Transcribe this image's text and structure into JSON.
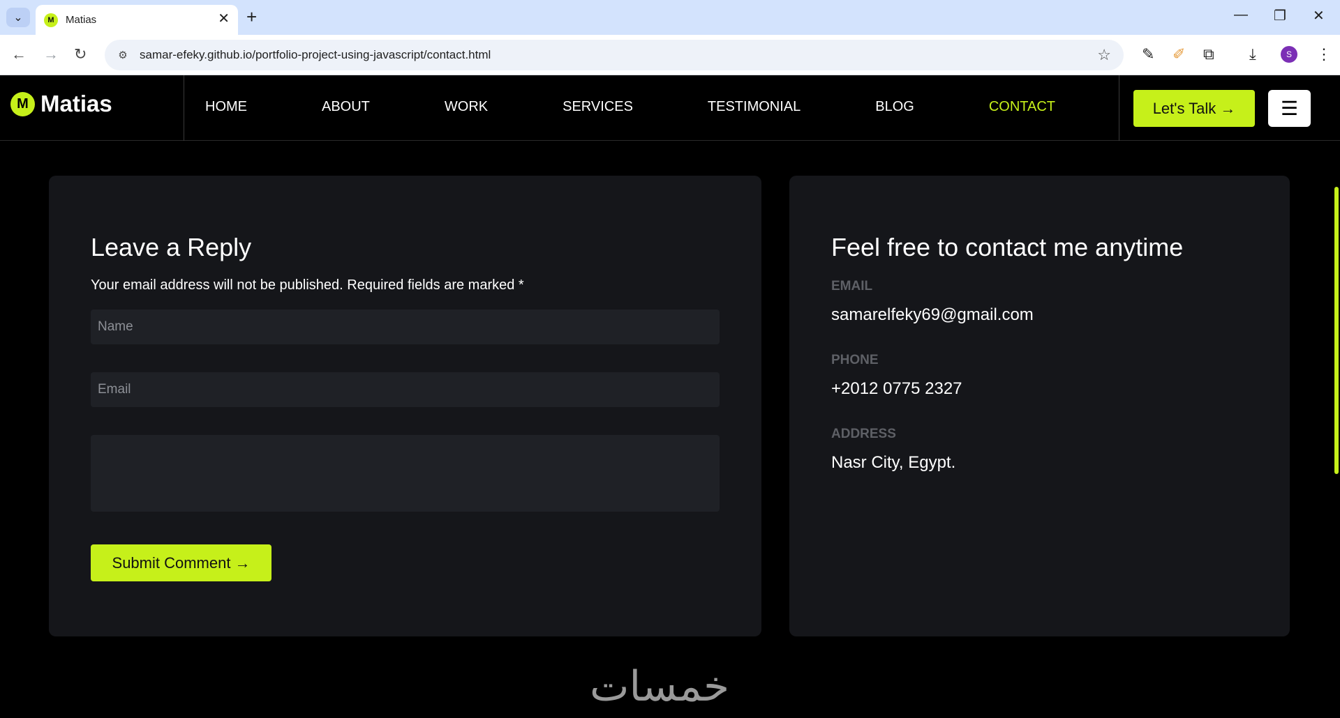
{
  "browser": {
    "tab_title": "Matias",
    "favicon_letter": "M",
    "url": "samar-efeky.github.io/portfolio-project-using-javascript/contact.html",
    "profile_initial": "S"
  },
  "header": {
    "logo_letter": "M",
    "logo_text": "Matias",
    "nav": [
      {
        "label": "HOME"
      },
      {
        "label": "ABOUT"
      },
      {
        "label": "WORK"
      },
      {
        "label": "SERVICES"
      },
      {
        "label": "TESTIMONIAL"
      },
      {
        "label": "BLOG"
      },
      {
        "label": "CONTACT",
        "active": true
      }
    ],
    "talk_label": "Let's Talk",
    "accent_color": "#c6f01a"
  },
  "reply_form": {
    "title": "Leave a Reply",
    "note": "Your email address will not be published. Required fields are marked *",
    "name_placeholder": "Name",
    "email_placeholder": "Email",
    "message_placeholder": "",
    "submit_label": "Submit Comment"
  },
  "contact": {
    "title": "Feel free to contact me anytime",
    "email_label": "EMAIL",
    "email_value": "samarelfeky69@gmail.com",
    "phone_label": "PHONE",
    "phone_value": "+2012 0775 2327",
    "address_label": "ADDRESS",
    "address_value": "Nasr City, Egypt."
  },
  "watermark": "خمسات",
  "icons": {
    "tab_menu": "chevron-down-icon",
    "back": "arrow-left-icon",
    "forward": "arrow-right-icon",
    "reload": "reload-icon",
    "bookmark": "star-icon",
    "hamburger": "menu-icon",
    "arrow": "arrow-right-icon"
  }
}
